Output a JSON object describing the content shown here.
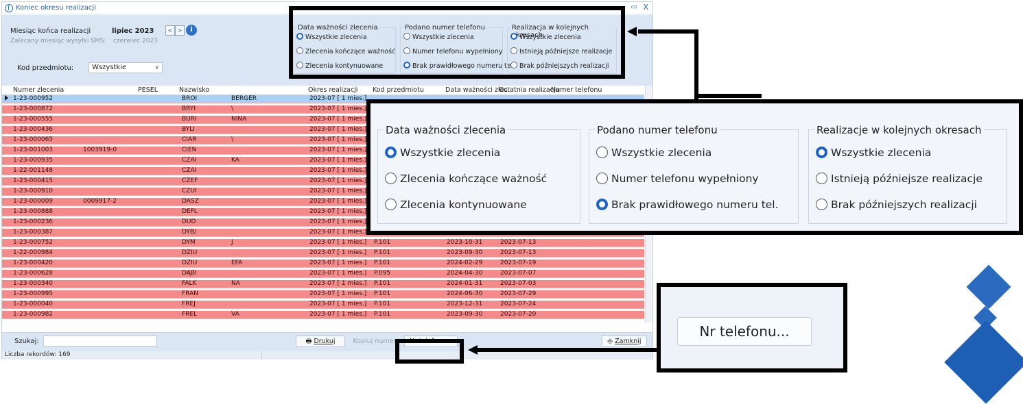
{
  "window": {
    "title": "Koniec okresu realizacji",
    "min_glyph": "▭",
    "close_glyph": "X"
  },
  "filters": {
    "end_month_label": "Miesiąc końca realizacji",
    "end_month_value": "lipiec 2023",
    "sms_month_label": "Zalecany miesiąc wysyłki SMS:",
    "sms_month_value": "czerwiec 2023",
    "prev_glyph": "<",
    "next_glyph": ">",
    "info_glyph": "i",
    "subject_code_label": "Kod przedmiotu:",
    "subject_code_value": "Wszystkie",
    "chevron_glyph": "∨"
  },
  "groups": [
    {
      "title": "Data ważności zlecenia",
      "options": [
        "Wszystkie zlecenia",
        "Zlecenia kończące ważność",
        "Zlecenia kontynuowane"
      ],
      "selected": 0
    },
    {
      "title": "Podano numer telefonu",
      "options": [
        "Wszystkie zlecenia",
        "Numer telefonu wypełniony",
        "Brak prawidłowego numeru tel."
      ],
      "selected": 2
    },
    {
      "title": "Realizacja w kolejnych okresach",
      "options": [
        "Wszystkie zlecenia",
        "Istnieją późniejsze realizacje",
        "Brak późniejszych realizacji"
      ],
      "selected": 0
    }
  ],
  "callout_groups": [
    {
      "title": "Data ważności zlecenia",
      "options": [
        "Wszystkie zlecenia",
        "Zlecenia kończące ważność",
        "Zlecenia kontynuowane"
      ],
      "selected": 0
    },
    {
      "title": "Podano numer telefonu",
      "options": [
        "Wszystkie zlecenia",
        "Numer telefonu wypełniony",
        "Brak prawidłowego numeru tel."
      ],
      "selected": 2
    },
    {
      "title": "Realizacje w kolejnych okresach",
      "options": [
        "Wszystkie zlecenia",
        "Istnieją późniejsze realizacje",
        "Brak późniejszych realizacji"
      ],
      "selected": 0
    }
  ],
  "table": {
    "columns": [
      "Numer zlecenia",
      "PESEL",
      "Nazwisko",
      "Okres realizacji",
      "Kod przedmiotu",
      "Data ważności zlec.",
      "Ostatnia realizacja",
      "Numer telefonu"
    ],
    "rows": [
      [
        "1-23-000952",
        "",
        "BROI",
        "BERGER",
        "2023-07  [ 1 mies.]",
        "",
        "",
        ""
      ],
      [
        "1-23-000872",
        "",
        "BRYI",
        "\\",
        "2023-07  [ 1 mies.]",
        "",
        "",
        ""
      ],
      [
        "1-23-000555",
        "",
        "BURI",
        "NINA",
        "2023-07  [ 1 mies.]",
        "",
        "",
        ""
      ],
      [
        "1-23-000436",
        "",
        "BYLI",
        "",
        "2023-07  [ 1 mies.]",
        "",
        "",
        ""
      ],
      [
        "1-23-000065",
        "",
        "CIAR",
        "\\",
        "2023-07  [ 1 mies.]",
        "",
        "",
        ""
      ],
      [
        "1-23-001003",
        "1003919-0",
        "CIEN",
        "",
        "2023-07  [ 1 mies.]",
        "",
        "",
        ""
      ],
      [
        "1-23-000935",
        "",
        "CZAI",
        "KA",
        "2023-07  [ 1 mies.]",
        "",
        "",
        ""
      ],
      [
        "1-22-001148",
        "",
        "CZAI",
        "",
        "2023-07  [ 1 mies.]",
        "",
        "",
        ""
      ],
      [
        "1-23-000415",
        "",
        "CZEF",
        "",
        "2023-07  [ 1 mies.]",
        "",
        "",
        ""
      ],
      [
        "1-23-000910",
        "",
        "CZUI",
        "",
        "2023-07  [ 1 mies.]",
        "",
        "",
        ""
      ],
      [
        "1-23-000009",
        "0009917-2",
        "DASZ",
        "",
        "2023-07  [ 1 mies.]",
        "",
        "",
        ""
      ],
      [
        "1-23-000888",
        "",
        "DEFL",
        "",
        "2023-07  [ 1 mies.]",
        "",
        "",
        ""
      ],
      [
        "1-23-000236",
        "",
        "DUD",
        "",
        "2023-07  [ 1 mies.]",
        "",
        "",
        ""
      ],
      [
        "1-23-000387",
        "",
        "DYB/",
        "",
        "2023-07  [ 1 mies.]",
        "",
        "",
        ""
      ],
      [
        "1-23-000752",
        "",
        "DYM",
        "J",
        "2023-07  [ 1 mies.]",
        "P.101",
        "2023-10-31",
        "2023-07-13"
      ],
      [
        "1-22-000984",
        "",
        "DZIU",
        "",
        "2023-07  [ 1 mies.]",
        "P.101",
        "2023-09-30",
        "2023-07-13"
      ],
      [
        "1-23-000420",
        "",
        "DZIU",
        "EFA",
        "2023-07  [ 1 mies.]",
        "P.101",
        "2024-02-29",
        "2023-07-19"
      ],
      [
        "1-23-000628",
        "",
        "DĄBI",
        "",
        "2023-07  [ 1 mies.]",
        "P.095",
        "2024-04-30",
        "2023-07-07"
      ],
      [
        "1-23-000340",
        "",
        "FALK",
        "NA",
        "2023-07  [ 1 mies.]",
        "P.101",
        "2024-01-31",
        "2023-07-03"
      ],
      [
        "1-23-000995",
        "",
        "FRAN",
        "",
        "2023-07  [ 1 mies.]",
        "P.101",
        "2024-06-30",
        "2023-07-29"
      ],
      [
        "1-23-000040",
        "",
        "FREJ",
        "",
        "2023-07  [ 1 mies.]",
        "P.101",
        "2023-12-31",
        "2023-07-24"
      ],
      [
        "1-23-000982",
        "",
        "FREL",
        "VA",
        "2023-07  [ 1 mies.]",
        "P.101",
        "2023-09-30",
        "2023-07-20"
      ]
    ]
  },
  "bottom": {
    "search_label": "Szukaj:",
    "print_label": "Drukuj",
    "copy_label": "Kopiuj numer",
    "phone_label": "Nr telefonu...",
    "close_label": "Zamknij",
    "record_count": "Liczba rekordów: 169"
  },
  "callout_button": {
    "label": "Nr telefonu..."
  },
  "colors": {
    "highlight_row": "#f48a8a",
    "selected_row": "#a9d1f5",
    "panel": "#dae6f4",
    "accent": "#1f63c4",
    "deco_blue": "#1c5fb4"
  }
}
